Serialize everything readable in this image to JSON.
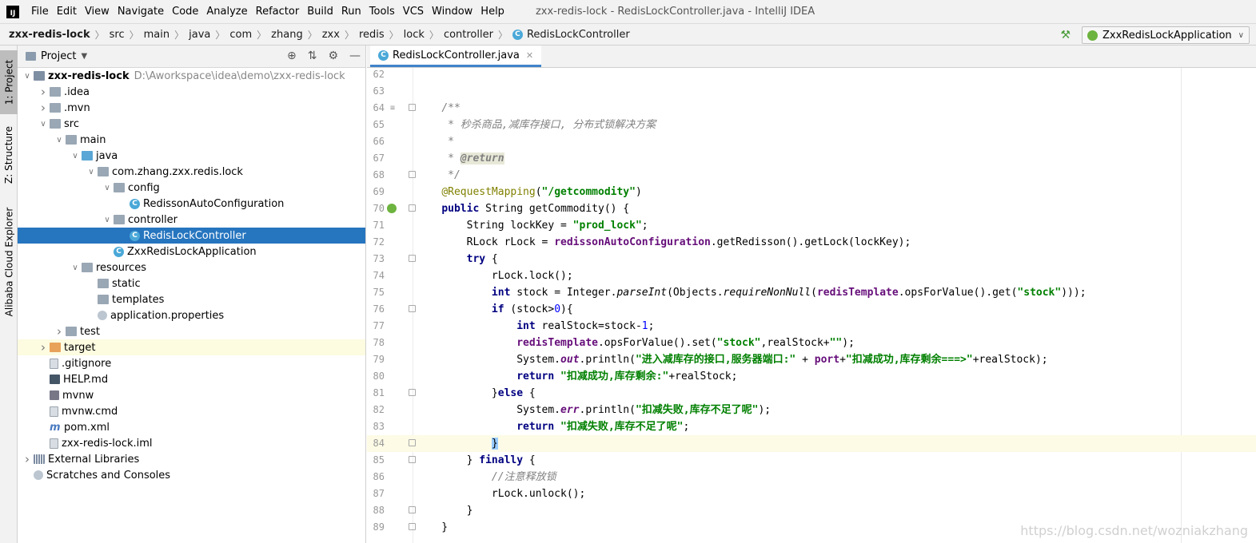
{
  "app": {
    "logo": "IJ",
    "menu": [
      "File",
      "Edit",
      "View",
      "Navigate",
      "Code",
      "Analyze",
      "Refactor",
      "Build",
      "Run",
      "Tools",
      "VCS",
      "Window",
      "Help"
    ],
    "window_title": "zxx-redis-lock - RedisLockController.java - IntelliJ IDEA"
  },
  "breadcrumb": [
    "zxx-redis-lock",
    "src",
    "main",
    "java",
    "com",
    "zhang",
    "zxx",
    "redis",
    "lock",
    "controller",
    "RedisLockController"
  ],
  "run_config": {
    "label": "ZxxRedisLockApplication"
  },
  "toolstrip": {
    "project_tab": "1: Project",
    "structure_tab": "Z: Structure",
    "cloud_tab": "Alibaba Cloud Explorer"
  },
  "project_panel": {
    "title": "Project",
    "tree": [
      {
        "label": "zxx-redis-lock",
        "hint": "D:\\Aworkspace\\idea\\demo\\zxx-redis-lock",
        "depth": 0,
        "arrow": "down",
        "icon": "module",
        "bold": true
      },
      {
        "label": ".idea",
        "depth": 1,
        "arrow": "right",
        "icon": "folder"
      },
      {
        "label": ".mvn",
        "depth": 1,
        "arrow": "right",
        "icon": "folder"
      },
      {
        "label": "src",
        "depth": 1,
        "arrow": "down",
        "icon": "folder"
      },
      {
        "label": "main",
        "depth": 2,
        "arrow": "down",
        "icon": "folder"
      },
      {
        "label": "java",
        "depth": 3,
        "arrow": "down",
        "icon": "folder-blue"
      },
      {
        "label": "com.zhang.zxx.redis.lock",
        "depth": 4,
        "arrow": "down",
        "icon": "folder"
      },
      {
        "label": "config",
        "depth": 5,
        "arrow": "down",
        "icon": "folder"
      },
      {
        "label": "RedissonAutoConfiguration",
        "depth": 6,
        "arrow": "",
        "icon": "class"
      },
      {
        "label": "controller",
        "depth": 5,
        "arrow": "down",
        "icon": "folder"
      },
      {
        "label": "RedisLockController",
        "depth": 6,
        "arrow": "",
        "icon": "class",
        "selected": true
      },
      {
        "label": "ZxxRedisLockApplication",
        "depth": 5,
        "arrow": "",
        "icon": "class"
      },
      {
        "label": "resources",
        "depth": 3,
        "arrow": "down",
        "icon": "folder-res"
      },
      {
        "label": "static",
        "depth": 4,
        "arrow": "",
        "icon": "folder"
      },
      {
        "label": "templates",
        "depth": 4,
        "arrow": "",
        "icon": "folder"
      },
      {
        "label": "application.properties",
        "depth": 4,
        "arrow": "",
        "icon": "scratch"
      },
      {
        "label": "test",
        "depth": 2,
        "arrow": "right",
        "icon": "folder"
      },
      {
        "label": "target",
        "depth": 1,
        "arrow": "right",
        "icon": "folder-orange",
        "highlight": true
      },
      {
        "label": ".gitignore",
        "depth": 1,
        "arrow": "",
        "icon": "file"
      },
      {
        "label": "HELP.md",
        "depth": 1,
        "arrow": "",
        "icon": "md"
      },
      {
        "label": "mvnw",
        "depth": 1,
        "arrow": "",
        "icon": "term"
      },
      {
        "label": "mvnw.cmd",
        "depth": 1,
        "arrow": "",
        "icon": "file"
      },
      {
        "label": "pom.xml",
        "depth": 1,
        "arrow": "",
        "icon": "m"
      },
      {
        "label": "zxx-redis-lock.iml",
        "depth": 1,
        "arrow": "",
        "icon": "file"
      },
      {
        "label": "External Libraries",
        "depth": 0,
        "arrow": "right",
        "icon": "lib"
      },
      {
        "label": "Scratches and Consoles",
        "depth": 0,
        "arrow": "",
        "icon": "scratch"
      }
    ]
  },
  "editor": {
    "tab_label": "RedisLockController.java",
    "current_line": 84,
    "lines": [
      {
        "n": 62,
        "html": ""
      },
      {
        "n": 63,
        "html": ""
      },
      {
        "n": 64,
        "html": "    <span class=\"cmt\">/**</span>"
      },
      {
        "n": 65,
        "html": "<span class=\"cmt\">     * 秒杀商品,减库存接口, 分布式锁解决方案</span>"
      },
      {
        "n": 66,
        "html": "<span class=\"cmt\">     *</span>"
      },
      {
        "n": 67,
        "html": "<span class=\"cmt\">     * </span><span class=\"tag\">@return</span>"
      },
      {
        "n": 68,
        "html": "<span class=\"cmt\">     */</span>"
      },
      {
        "n": 69,
        "html": "    <span class=\"ann\">@RequestMapping</span>(<span class=\"str\">\"/getcommodity\"</span>)"
      },
      {
        "n": 70,
        "html": "    <span class=\"kw\">public</span> String getCommodity() {"
      },
      {
        "n": 71,
        "html": "        String lockKey = <span class=\"str\">\"prod_lock\"</span>;"
      },
      {
        "n": 72,
        "html": "        RLock rLock = <span class=\"fld\">redissonAutoConfiguration</span>.getRedisson().getLock(lockKey);"
      },
      {
        "n": 73,
        "html": "        <span class=\"kw\">try</span> {"
      },
      {
        "n": 74,
        "html": "            rLock.lock();"
      },
      {
        "n": 75,
        "html": "            <span class=\"kw\">int</span> stock = Integer.<span class=\"ital\">parseInt</span>(Objects.<span class=\"ital\">requireNonNull</span>(<span class=\"fld\">redisTemplate</span>.opsForValue().get(<span class=\"str\">\"stock\"</span>)));"
      },
      {
        "n": 76,
        "html": "            <span class=\"kw\">if</span> (stock><span class=\"num\">0</span>){"
      },
      {
        "n": 77,
        "html": "                <span class=\"kw\">int</span> realStock=stock-<span class=\"num\">1</span>;"
      },
      {
        "n": 78,
        "html": "                <span class=\"fld\">redisTemplate</span>.opsForValue().set(<span class=\"str\">\"stock\"</span>,realStock+<span class=\"str\">\"\"</span>);"
      },
      {
        "n": 79,
        "html": "                System.<span class=\"fld ital\">out</span>.println(<span class=\"str\">\"进入减库存的接口,服务器端口:\"</span> + <span class=\"fld\">port</span>+<span class=\"str\">\"扣减成功,库存剩余===>\"</span>+realStock);"
      },
      {
        "n": 80,
        "html": "                <span class=\"kw\">return</span> <span class=\"str\">\"扣减成功,库存剩余:\"</span>+realStock;"
      },
      {
        "n": 81,
        "html": "            }<span class=\"kw\">else</span> {"
      },
      {
        "n": 82,
        "html": "                System.<span class=\"fld ital\">err</span>.println(<span class=\"str\">\"扣减失败,库存不足了呢\"</span>);"
      },
      {
        "n": 83,
        "html": "                <span class=\"kw\">return</span> <span class=\"str\">\"扣减失败,库存不足了呢\"</span>;"
      },
      {
        "n": 84,
        "html": "            <span class=\"brace-hl\">}</span>"
      },
      {
        "n": 85,
        "html": "        } <span class=\"kw\">finally</span> {"
      },
      {
        "n": 86,
        "html": "            <span class=\"cmt\">//注意释放锁</span>"
      },
      {
        "n": 87,
        "html": "            rLock.unlock();"
      },
      {
        "n": 88,
        "html": "        }"
      },
      {
        "n": 89,
        "html": "    }"
      }
    ]
  },
  "watermark": "https://blog.csdn.net/wozniakzhang"
}
